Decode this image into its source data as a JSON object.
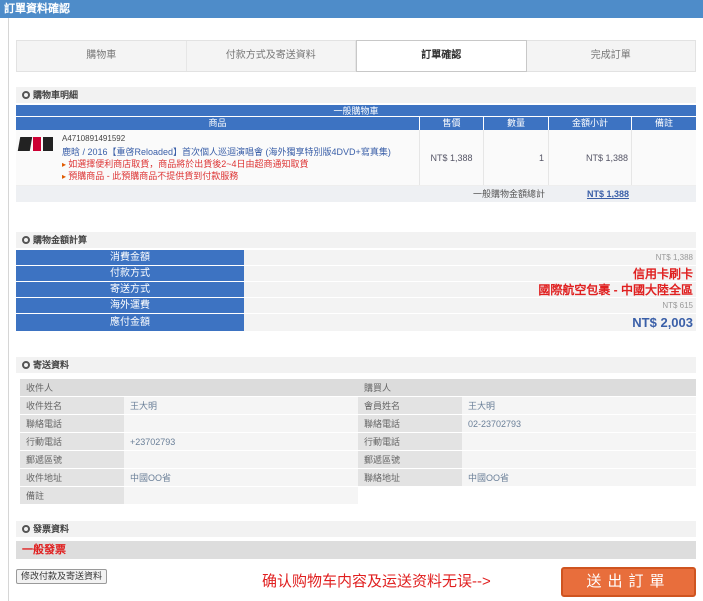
{
  "window": {
    "title": "訂單資料確認"
  },
  "steps": [
    {
      "label": "購物車"
    },
    {
      "label": "付款方式及寄送資料"
    },
    {
      "label": "訂單確認"
    },
    {
      "label": "完成訂單"
    }
  ],
  "cart": {
    "section_title": "購物車明細",
    "group_title": "一般購物車",
    "columns": [
      "商品",
      "售價",
      "數量",
      "金額小計",
      "備註"
    ],
    "items": [
      {
        "sku": "A4710891491592",
        "name": "鹿晗 / 2016【重啓Reloaded】首次個人巡迴演唱會 (海外獨享特別版4DVD+寫真集)",
        "notes": [
          "如選擇便利商店取貨，商品將於出貨後2~4日由超商通知取貨",
          "預購商品 - 此預購商品不提供貨到付款服務"
        ],
        "price": "NT$ 1,388",
        "quantity": "1",
        "subtotal": "NT$ 1,388",
        "remark": ""
      }
    ],
    "total_label": "一般購物金額總計",
    "total_value": "NT$ 1,388"
  },
  "amount": {
    "section_title": "購物金額計算",
    "rows": [
      {
        "label": "消費金額",
        "value": "NT$ 1,388"
      },
      {
        "label": "付款方式",
        "value": "信用卡刷卡"
      },
      {
        "label": "寄送方式",
        "value": "國際航空包裹 - 中國大陸全區"
      },
      {
        "label": "海外運費",
        "value": "NT$ 615"
      },
      {
        "label": "應付金額",
        "value": "NT$ 2,003"
      }
    ]
  },
  "shipping": {
    "section_title": "寄送資料",
    "recipient": {
      "title": "收件人",
      "rows": [
        {
          "label": "收件姓名",
          "value": "王大明"
        },
        {
          "label": "聯絡電話",
          "value": ""
        },
        {
          "label": "行動電話",
          "value": "+23702793"
        },
        {
          "label": "郵遞區號",
          "value": ""
        },
        {
          "label": "收件地址",
          "value": "中國OO省"
        },
        {
          "label": "備註",
          "value": ""
        }
      ]
    },
    "buyer": {
      "title": "購買人",
      "rows": [
        {
          "label": "會員姓名",
          "value": "王大明"
        },
        {
          "label": "聯絡電話",
          "value": "02-23702793"
        },
        {
          "label": "行動電話",
          "value": ""
        },
        {
          "label": "郵遞區號",
          "value": ""
        },
        {
          "label": "聯絡地址",
          "value": "中國OO省"
        }
      ]
    }
  },
  "invoice": {
    "section_title": "發票資料",
    "type": "一般發票"
  },
  "actions": {
    "modify_label": "修改付款及寄送資料",
    "note": "确认购物车内容及运送资料无误-->",
    "submit_label": "送出訂單"
  }
}
